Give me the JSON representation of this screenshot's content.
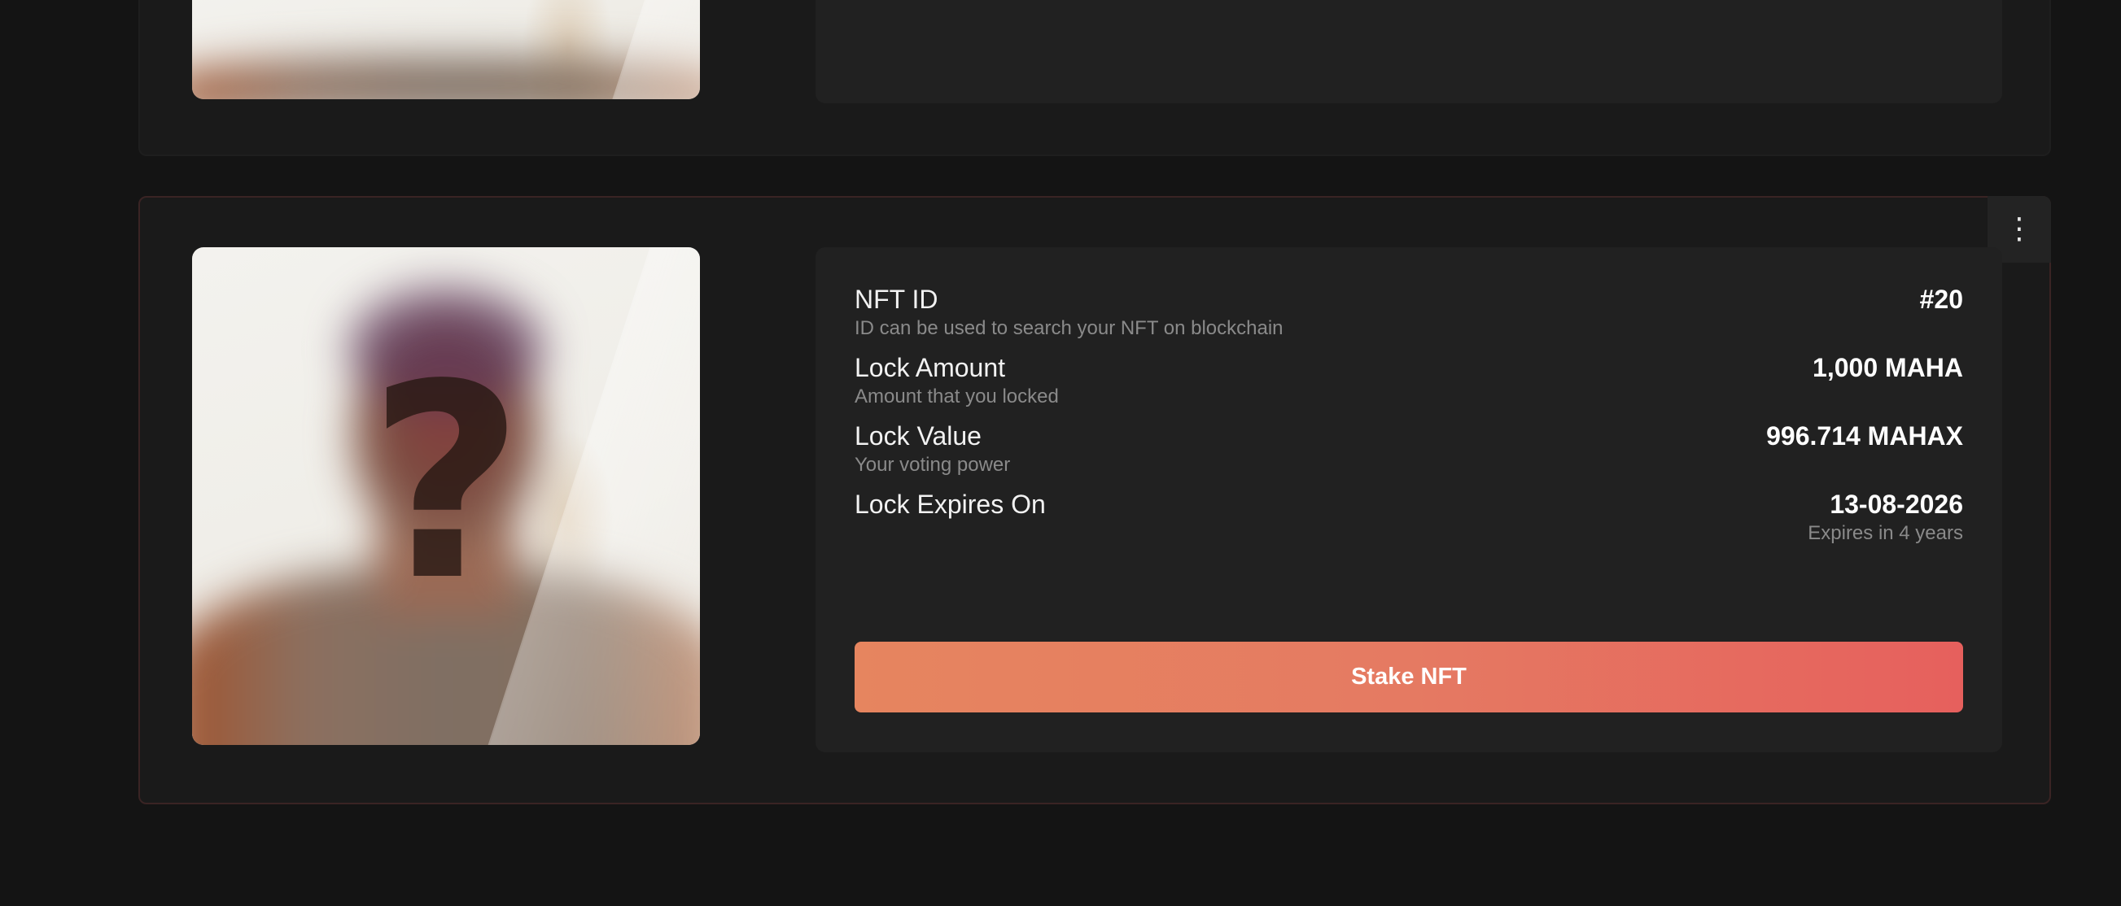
{
  "cards": [
    {
      "image": {
        "alt_glyph": "?"
      }
    },
    {
      "menu_icon": "more-vertical-icon",
      "menu_glyph": "⋮",
      "image": {
        "alt_glyph": "?"
      },
      "details": {
        "nft_id": {
          "label": "NFT ID",
          "sub": "ID can be used to search your NFT on blockchain",
          "value": "#20"
        },
        "lock_amount": {
          "label": "Lock Amount",
          "sub": "Amount that you locked",
          "value": "1,000 MAHA"
        },
        "lock_value": {
          "label": "Lock Value",
          "sub": "Your voting power",
          "value": "996.714 MAHAX"
        },
        "lock_expires": {
          "label": "Lock Expires On",
          "value": "13-08-2026",
          "value_sub": "Expires in 4 years"
        }
      },
      "stake_button_label": "Stake NFT"
    }
  ],
  "colors": {
    "background": "#141414",
    "card": "#1a1a1a",
    "panel": "#212121",
    "button_gradient_start": "#e6855f",
    "button_gradient_end": "#e6605d"
  }
}
